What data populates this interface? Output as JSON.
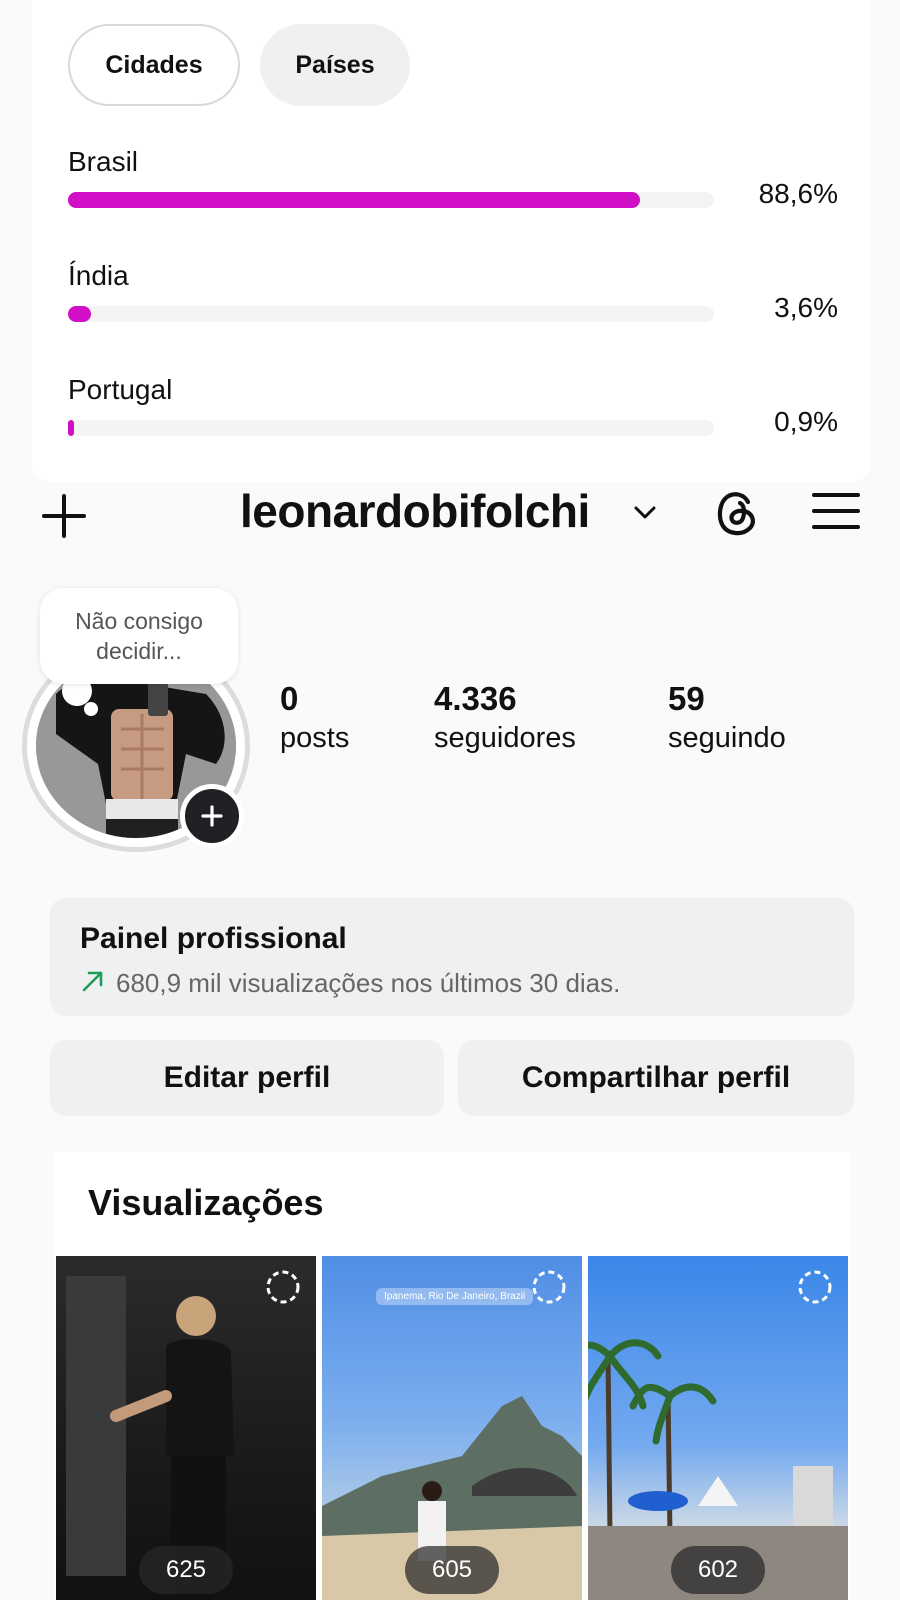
{
  "audience": {
    "tabs": [
      "Cidades",
      "Países"
    ],
    "active_tab": "Cidades",
    "bar_color": "#d10fc6",
    "countries": [
      {
        "name": "Brasil",
        "percent_label": "88,6%",
        "percent": 88.6
      },
      {
        "name": "Índia",
        "percent_label": "3,6%",
        "percent": 3.6
      },
      {
        "name": "Portugal",
        "percent_label": "0,9%",
        "percent": 0.9
      }
    ]
  },
  "header": {
    "username": "leonardobifolchi",
    "icons": [
      "plus-icon",
      "chevron-down-icon",
      "threads-icon",
      "menu-icon"
    ]
  },
  "profile": {
    "note": "Não consigo decidir...",
    "stats": [
      {
        "value": "0",
        "label": "posts"
      },
      {
        "value": "4.336",
        "label": "seguidores"
      },
      {
        "value": "59",
        "label": "seguindo"
      }
    ]
  },
  "dashboard": {
    "title": "Painel profissional",
    "subtitle": "680,9 mil visualizações nos últimos 30 dias.",
    "trend_color": "#1f9d55"
  },
  "buttons": {
    "edit": "Editar perfil",
    "share": "Compartilhar perfil"
  },
  "views": {
    "title": "Visualizações",
    "items": [
      {
        "count": "625"
      },
      {
        "count": "605",
        "location": "Ipanema, Rio De Janeiro, Brazil"
      },
      {
        "count": "602"
      }
    ]
  }
}
